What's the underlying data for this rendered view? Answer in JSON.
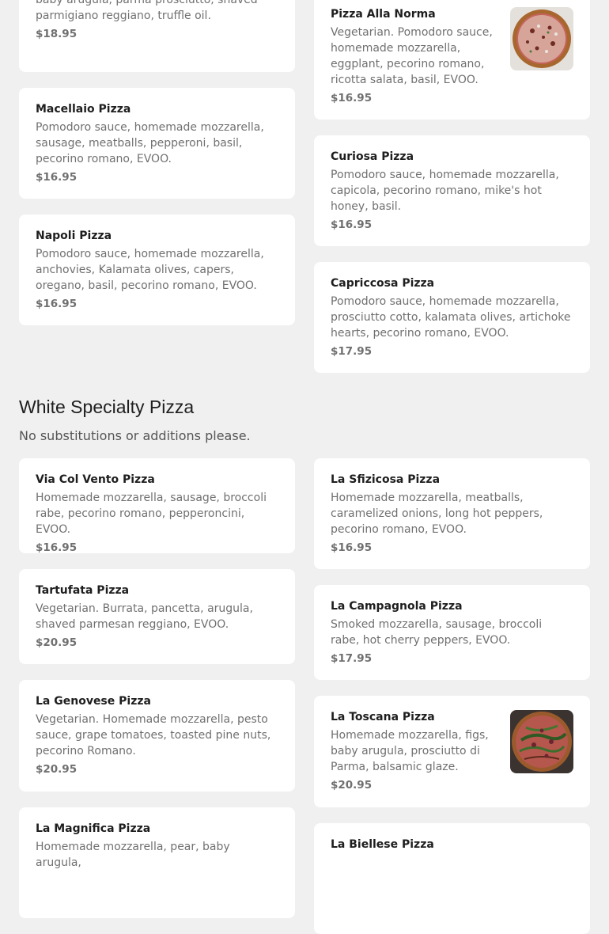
{
  "section_top": {
    "items_left": [
      {
        "name": "",
        "desc": "Pomodoro sauce, homemade mozzarella, baby arugula, parma prosciutto, shaved parmigiano reggiano, truffle oil.",
        "price": "$18.95"
      },
      {
        "name": "Macellaio Pizza",
        "desc": "Pomodoro sauce, homemade mozzarella, sausage, meatballs, pepperoni, basil, pecorino romano, EVOO.",
        "price": "$16.95"
      },
      {
        "name": "Napoli Pizza",
        "desc": "Pomodoro sauce, homemade mozzarella, anchovies, Kalamata olives, capers, oregano, basil, pecorino romano, EVOO.",
        "price": "$16.95"
      }
    ],
    "items_right": [
      {
        "name": "Pizza Alla Norma",
        "desc": "Vegetarian. Pomodoro sauce, homemade mozzarella, eggplant, pecorino romano, ricotta salata, basil, EVOO.",
        "price": "$16.95",
        "image": "pizza-alla-norma-photo"
      },
      {
        "name": "Curiosa Pizza",
        "desc": "Pomodoro sauce, homemade mozzarella, capicola, pecorino romano, mike's hot honey, basil.",
        "price": "$16.95"
      },
      {
        "name": "Capriccosa Pizza",
        "desc": "Pomodoro sauce, homemade mozzarella, prosciutto cotto, kalamata olives, artichoke hearts, pecorino romano, EVOO.",
        "price": "$17.95"
      }
    ]
  },
  "white_specialty": {
    "title": "White Specialty Pizza",
    "note": "No substitutions or additions please.",
    "items_left": [
      {
        "name": "Via Col Vento Pizza",
        "desc": "Homemade mozzarella, sausage, broccoli rabe, pecorino romano, pepperoncini, EVOO.",
        "price": "$16.95"
      },
      {
        "name": "Tartufata Pizza",
        "desc": "Vegetarian. Burrata, pancetta, arugula, shaved parmesan reggiano, EVOO.",
        "price": "$20.95"
      },
      {
        "name": "La Genovese Pizza",
        "desc": "Vegetarian. Homemade mozzarella, pesto sauce, grape tomatoes, toasted pine nuts, pecorino Romano.",
        "price": "$20.95"
      },
      {
        "name": "La Magnifica Pizza",
        "desc": "Homemade mozzarella, pear, baby arugula,",
        "price": ""
      }
    ],
    "items_right": [
      {
        "name": "La Sfizicosa Pizza",
        "desc": "Homemade mozzarella, meatballs, caramelized onions, long hot peppers, pecorino romano, EVOO.",
        "price": "$16.95"
      },
      {
        "name": "La Campagnola Pizza",
        "desc": "Smoked mozzarella, sausage, broccoli rabe, hot cherry peppers, EVOO.",
        "price": "$17.95"
      },
      {
        "name": "La Toscana Pizza",
        "desc": "Homemade mozzarella, figs, baby arugula, prosciutto di Parma, balsamic glaze.",
        "price": "$20.95",
        "image": "la-toscana-photo"
      },
      {
        "name": "La Biellese Pizza",
        "desc": "",
        "price": ""
      }
    ]
  },
  "colors": {
    "background": "#f0f0f0",
    "card": "#ffffff",
    "title_text": "#1e1e1e",
    "body_text": "#707070"
  }
}
